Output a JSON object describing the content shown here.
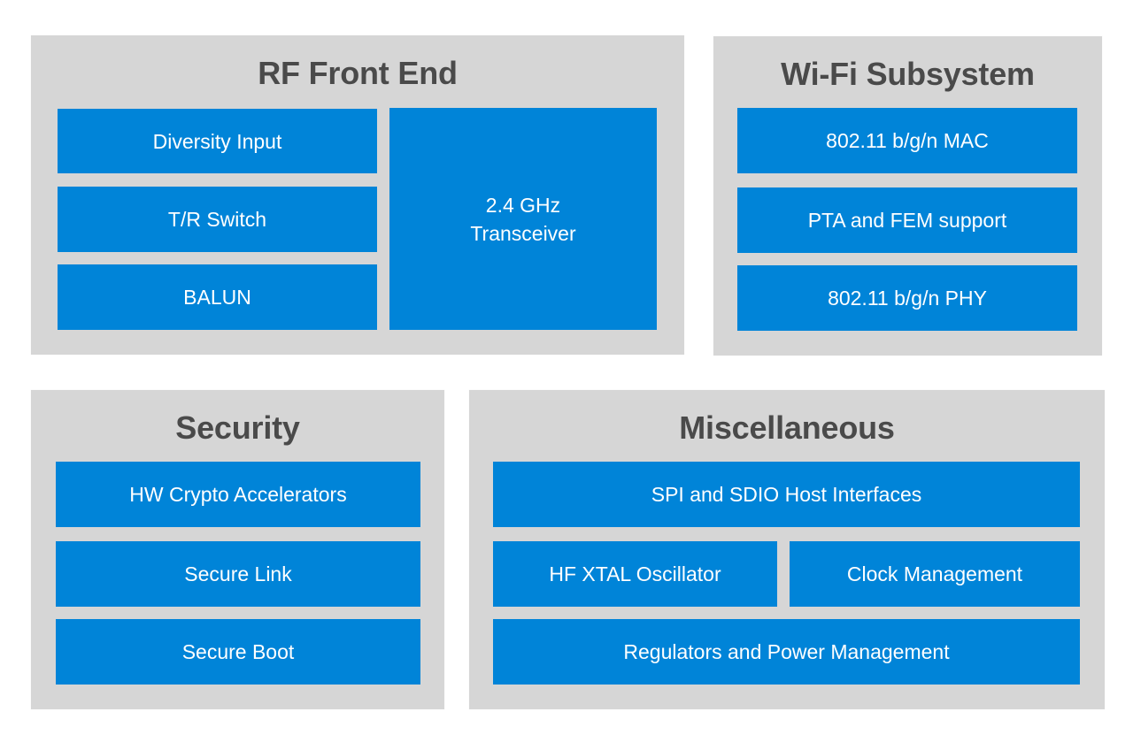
{
  "colors": {
    "panel_background": "#d6d6d6",
    "block_background": "#0084d8",
    "block_text": "#ffffff",
    "title_text": "#4a4a4a",
    "page_background": "#ffffff"
  },
  "panels": {
    "rf_front_end": {
      "title": "RF Front End",
      "blocks": {
        "diversity_input": "Diversity Input",
        "tr_switch": "T/R Switch",
        "balun": "BALUN",
        "transceiver_line1": "2.4 GHz",
        "transceiver_line2": "Transceiver"
      }
    },
    "wifi_subsystem": {
      "title": "Wi-Fi Subsystem",
      "blocks": {
        "mac": "802.11 b/g/n MAC",
        "pta_fem": "PTA and FEM support",
        "phy": "802.11 b/g/n PHY"
      }
    },
    "security": {
      "title": "Security",
      "blocks": {
        "crypto": "HW Crypto Accelerators",
        "secure_link": "Secure Link",
        "secure_boot": "Secure Boot"
      }
    },
    "miscellaneous": {
      "title": "Miscellaneous",
      "blocks": {
        "host_interfaces": "SPI and SDIO Host Interfaces",
        "hf_xtal": "HF XTAL Oscillator",
        "clock_management": "Clock Management",
        "regulators": "Regulators and Power Management"
      }
    }
  }
}
